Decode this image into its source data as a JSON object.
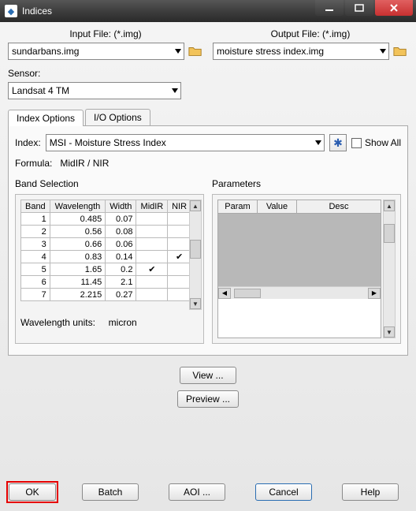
{
  "window": {
    "title": "Indices"
  },
  "labels": {
    "input_file": "Input File: (*.img)",
    "output_file": "Output File: (*.img)",
    "sensor": "Sensor:",
    "index": "Index:",
    "show_all": "Show All",
    "formula_label": "Formula:",
    "formula_value": "MidIR / NIR",
    "band_selection": "Band Selection",
    "parameters": "Parameters",
    "wavelength_units_label": "Wavelength units:",
    "wavelength_units_value": "micron"
  },
  "values": {
    "input_file": "sundarbans.img",
    "output_file": "moisture stress index.img",
    "sensor": "Landsat 4 TM",
    "index": "MSI - Moisture Stress Index"
  },
  "tabs": {
    "index_options": "Index Options",
    "io_options": "I/O Options"
  },
  "band_table": {
    "headers": {
      "band": "Band",
      "wavelength": "Wavelength",
      "width": "Width",
      "midir": "MidIR",
      "nir": "NIR"
    },
    "rows": [
      {
        "band": "1",
        "wavelength": "0.485",
        "width": "0.07",
        "midir": "",
        "nir": ""
      },
      {
        "band": "2",
        "wavelength": "0.56",
        "width": "0.08",
        "midir": "",
        "nir": ""
      },
      {
        "band": "3",
        "wavelength": "0.66",
        "width": "0.06",
        "midir": "",
        "nir": ""
      },
      {
        "band": "4",
        "wavelength": "0.83",
        "width": "0.14",
        "midir": "",
        "nir": "✔"
      },
      {
        "band": "5",
        "wavelength": "1.65",
        "width": "0.2",
        "midir": "✔",
        "nir": ""
      },
      {
        "band": "6",
        "wavelength": "11.45",
        "width": "2.1",
        "midir": "",
        "nir": ""
      },
      {
        "band": "7",
        "wavelength": "2.215",
        "width": "0.27",
        "midir": "",
        "nir": ""
      }
    ]
  },
  "param_table": {
    "headers": {
      "param": "Param",
      "value": "Value",
      "desc": "Desc"
    }
  },
  "buttons": {
    "view": "View ...",
    "preview": "Preview ...",
    "ok": "OK",
    "batch": "Batch",
    "aoi": "AOI ...",
    "cancel": "Cancel",
    "help": "Help"
  }
}
